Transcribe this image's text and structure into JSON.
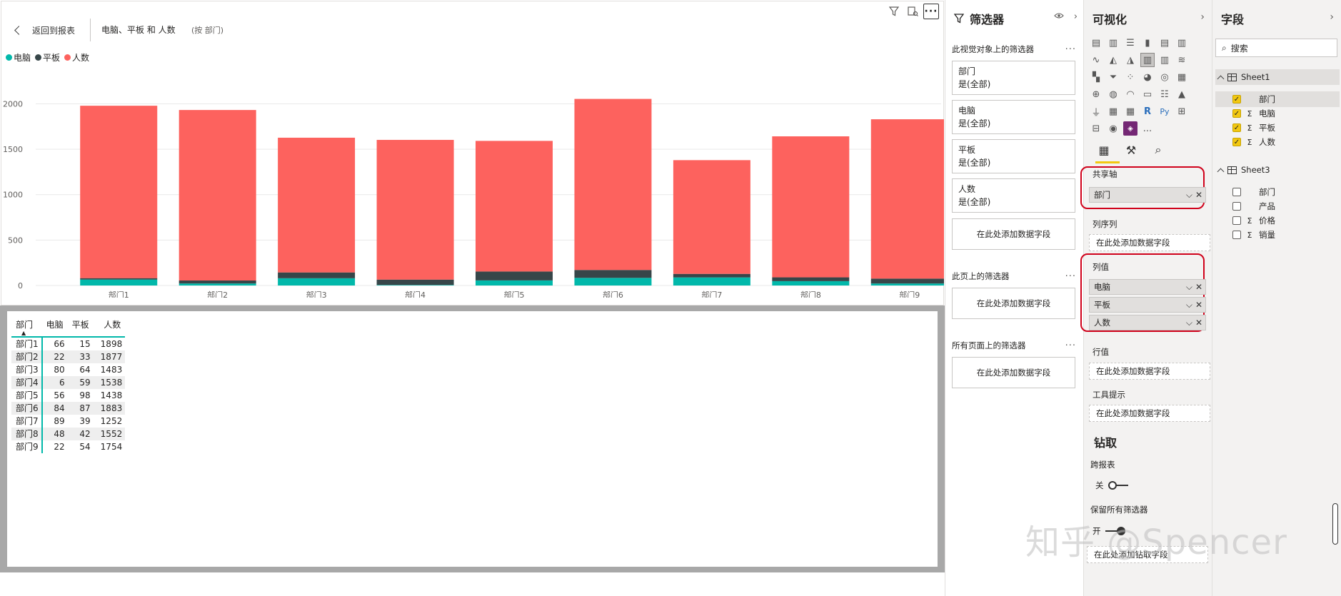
{
  "report_header": {
    "back_label": "返回到报表",
    "visual_title": "电脑、平板 和 人数",
    "visual_subtitle": "(按 部门)"
  },
  "legend": [
    {
      "name": "电脑",
      "color": "#01b8aa"
    },
    {
      "name": "平板",
      "color": "#374649"
    },
    {
      "name": "人数",
      "color": "#fd625e"
    }
  ],
  "chart_data": {
    "type": "bar",
    "stacked": true,
    "categories": [
      "部门1",
      "部门2",
      "部门3",
      "部门4",
      "部门5",
      "部门6",
      "部门7",
      "部门8",
      "部门9"
    ],
    "series": [
      {
        "name": "电脑",
        "color": "#01b8aa",
        "values": [
          66,
          22,
          80,
          6,
          56,
          84,
          89,
          48,
          22
        ]
      },
      {
        "name": "平板",
        "color": "#374649",
        "values": [
          15,
          33,
          64,
          59,
          98,
          87,
          39,
          42,
          54
        ]
      },
      {
        "name": "人数",
        "color": "#fd625e",
        "values": [
          1898,
          1877,
          1483,
          1538,
          1438,
          1883,
          1252,
          1552,
          1754
        ]
      }
    ],
    "yticks": [
      "0",
      "500",
      "1000",
      "1500",
      "2000"
    ],
    "ylim": [
      0,
      2200
    ],
    "grid": true,
    "legend_position": "top-left"
  },
  "table": {
    "columns": [
      "部门",
      "电脑",
      "平板",
      "人数"
    ],
    "sort_indicator": "▲",
    "rows": [
      [
        "部门1",
        "66",
        "15",
        "1898"
      ],
      [
        "部门2",
        "22",
        "33",
        "1877"
      ],
      [
        "部门3",
        "80",
        "64",
        "1483"
      ],
      [
        "部门4",
        "6",
        "59",
        "1538"
      ],
      [
        "部门5",
        "56",
        "98",
        "1438"
      ],
      [
        "部门6",
        "84",
        "87",
        "1883"
      ],
      [
        "部门7",
        "89",
        "39",
        "1252"
      ],
      [
        "部门8",
        "48",
        "42",
        "1552"
      ],
      [
        "部门9",
        "22",
        "54",
        "1754"
      ]
    ]
  },
  "filters": {
    "title": "筛选器",
    "visual_section": "此视觉对象上的筛选器",
    "cards": [
      {
        "field": "部门",
        "value": "是(全部)"
      },
      {
        "field": "电脑",
        "value": "是(全部)"
      },
      {
        "field": "平板",
        "value": "是(全部)"
      },
      {
        "field": "人数",
        "value": "是(全部)"
      }
    ],
    "add_field": "在此处添加数据字段",
    "page_section": "此页上的筛选器",
    "all_pages_section": "所有页面上的筛选器",
    "more": "..."
  },
  "visualizations": {
    "title": "可视化",
    "shared_axis_label": "共享轴",
    "shared_axis_field": "部门",
    "column_series_label": "列序列",
    "column_values_label": "列值",
    "column_values": [
      "电脑",
      "平板",
      "人数"
    ],
    "row_values_label": "行值",
    "tooltips_label": "工具提示",
    "add_field": "在此处添加数据字段",
    "drill_title": "钻取",
    "cross_report_label": "跨报表",
    "cross_report_state": "关",
    "keep_filters_label": "保留所有筛选器",
    "keep_filters_state": "开",
    "drill_add": "在此处添加钻取字段",
    "more_visuals": "..."
  },
  "fields": {
    "title": "字段",
    "search_placeholder": "搜索",
    "tables": [
      {
        "name": "Sheet1",
        "fields": [
          {
            "name": "部门",
            "checked": true,
            "sigma": false
          },
          {
            "name": "电脑",
            "checked": true,
            "sigma": true
          },
          {
            "name": "平板",
            "checked": true,
            "sigma": true
          },
          {
            "name": "人数",
            "checked": true,
            "sigma": true
          }
        ]
      },
      {
        "name": "Sheet3",
        "fields": [
          {
            "name": "部门",
            "checked": false,
            "sigma": false
          },
          {
            "name": "产品",
            "checked": false,
            "sigma": false
          },
          {
            "name": "价格",
            "checked": false,
            "sigma": true
          },
          {
            "name": "销量",
            "checked": false,
            "sigma": true
          }
        ]
      }
    ]
  },
  "watermark": "知乎 @Spencer"
}
